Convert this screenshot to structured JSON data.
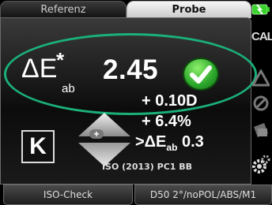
{
  "tabs": {
    "reference": "Referenz",
    "sample": "Probe"
  },
  "measurement": {
    "delta_symbol": "ΔE",
    "star": "*",
    "subscript": "ab",
    "value": "2.45",
    "pass": true
  },
  "indicator": {
    "letter": "K",
    "plus": "+"
  },
  "deviations": {
    "density": "+ 0.10D",
    "percent": "+ 6.4%",
    "tolerance_prefix": ">ΔE",
    "tolerance_sub": "ab",
    "tolerance_value": "0.3"
  },
  "standard": "ISO (2013) PC1 BB",
  "bottom": {
    "iso_check": "ISO-Check",
    "mode": "D50 2°/noPOL/ABS/M1"
  },
  "toolbar": {
    "cal_label": "CAL",
    "icons": [
      "battery-icon",
      "cal-icon",
      "triangle-icon",
      "cancel-icon",
      "sample-icon",
      "settings-icon"
    ]
  },
  "colors": {
    "accent_green": "#1bb07a",
    "ok_green": "#2aa52a"
  }
}
